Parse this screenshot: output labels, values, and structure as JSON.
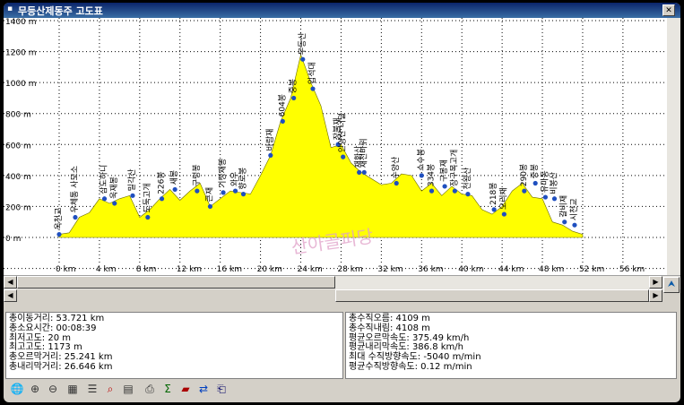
{
  "window": {
    "title": "무등산제동주 고도표"
  },
  "chart_data": {
    "type": "area",
    "x": [
      0,
      1,
      2,
      3,
      4,
      5,
      6,
      7,
      8,
      9,
      10,
      11,
      12,
      13,
      14,
      15,
      16,
      17,
      18,
      19,
      20,
      21,
      22,
      23,
      23.5,
      24,
      25,
      26,
      27,
      28,
      29,
      30,
      31,
      32,
      33,
      34,
      35,
      36,
      37,
      38,
      39,
      40,
      41,
      42,
      43,
      44,
      45,
      46,
      47,
      48,
      49,
      50,
      51,
      52
    ],
    "y": [
      20,
      30,
      130,
      160,
      250,
      220,
      250,
      270,
      130,
      180,
      250,
      310,
      240,
      300,
      350,
      200,
      250,
      300,
      290,
      280,
      400,
      530,
      750,
      900,
      1040,
      1180,
      1000,
      850,
      580,
      600,
      480,
      420,
      380,
      340,
      350,
      410,
      400,
      300,
      350,
      270,
      330,
      280,
      270,
      180,
      150,
      200,
      300,
      350,
      260,
      250,
      100,
      80,
      40,
      20
    ],
    "xticks": [
      "0 km",
      "4 km",
      "8 km",
      "12 km",
      "16 km",
      "20 km",
      "24 km",
      "28 km",
      "32 km",
      "36 km",
      "40 km",
      "44 km",
      "48 km",
      "52 km",
      "56 km"
    ],
    "yticks": [
      "0 m",
      "200 m",
      "400 m",
      "600 m",
      "800 m",
      "1000 m",
      "1200 m",
      "1400 m"
    ],
    "xlim": [
      0,
      56
    ],
    "ylim": [
      0,
      1400
    ],
    "grid": true,
    "fill_color": "#ffff00",
    "marker_color": "#1f4fbf",
    "waypoints": [
      {
        "x": 0,
        "y": 20,
        "label": "옥천교"
      },
      {
        "x": 1.6,
        "y": 130,
        "label": "우체통 사모소"
      },
      {
        "x": 4.5,
        "y": 250,
        "label": "삼도하니"
      },
      {
        "x": 5.5,
        "y": 220,
        "label": "욱재봉"
      },
      {
        "x": 7.3,
        "y": 270,
        "label": "밀각산"
      },
      {
        "x": 8.8,
        "y": 130,
        "label": "도둑고개"
      },
      {
        "x": 10.2,
        "y": 250,
        "label": "226봉"
      },
      {
        "x": 11.5,
        "y": 310,
        "label": "새봉"
      },
      {
        "x": 13.7,
        "y": 300,
        "label": "구렁봉"
      },
      {
        "x": 15,
        "y": 200,
        "label": "큰재"
      },
      {
        "x": 16.3,
        "y": 290,
        "label": "기정재봉"
      },
      {
        "x": 17.5,
        "y": 300,
        "label": "와우"
      },
      {
        "x": 18.3,
        "y": 280,
        "label": "향로봉"
      },
      {
        "x": 21,
        "y": 530,
        "label": "바람재"
      },
      {
        "x": 22.2,
        "y": 750,
        "label": "604봉"
      },
      {
        "x": 23.3,
        "y": 900,
        "label": "중봉"
      },
      {
        "x": 24.2,
        "y": 1150,
        "label": "무등산"
      },
      {
        "x": 25.2,
        "y": 960,
        "label": "입석대"
      },
      {
        "x": 27.7,
        "y": 600,
        "label": "장불재"
      },
      {
        "x": 28.2,
        "y": 520,
        "label": "안양산 너덜"
      },
      {
        "x": 29.8,
        "y": 420,
        "label": "재화산"
      },
      {
        "x": 30.3,
        "y": 420,
        "label": "재천바위"
      },
      {
        "x": 33.5,
        "y": 350,
        "label": "수양산"
      },
      {
        "x": 36,
        "y": 400,
        "label": "소수봉"
      },
      {
        "x": 37,
        "y": 300,
        "label": "334봉"
      },
      {
        "x": 38.3,
        "y": 330,
        "label": "구봉재"
      },
      {
        "x": 39.3,
        "y": 300,
        "label": "장구목고개"
      },
      {
        "x": 40.6,
        "y": 280,
        "label": "천왕산"
      },
      {
        "x": 43.2,
        "y": 180,
        "label": "218봉"
      },
      {
        "x": 44.2,
        "y": 150,
        "label": "오리재"
      },
      {
        "x": 46.2,
        "y": 300,
        "label": "290봉"
      },
      {
        "x": 47.3,
        "y": 350,
        "label": "증봉"
      },
      {
        "x": 48.3,
        "y": 260,
        "label": "유마동"
      },
      {
        "x": 49.2,
        "y": 250,
        "label": "비봉산"
      },
      {
        "x": 50.2,
        "y": 100,
        "label": "갈비재"
      },
      {
        "x": 51.2,
        "y": 80,
        "label": "시천교"
      }
    ],
    "watermark": "산아골피당"
  },
  "stats_left": [
    "총이동거리: 53.721 km",
    "총소요시간: 00:08:39",
    "최저고도: 20 m",
    "최고고도: 1173 m",
    "총오르막거리: 25.241 km",
    "총내리막거리: 26.646 km"
  ],
  "stats_right": [
    "총수직오름: 4109 m",
    "총수직내림: 4108 m",
    "평균오르막속도: 375.49 km/h",
    "평균내리막속도: 386.8 km/h",
    "최대 수직방향속도: -5040 m/min",
    "평균수직방향속도: 0.12 m/min"
  ],
  "toolbar": {
    "icons": [
      "globe-icon",
      "zoom-in-icon",
      "zoom-out-icon",
      "grid-icon",
      "list-icon",
      "magnifier-icon",
      "page-icon",
      "print-icon",
      "sigma-icon",
      "book-icon",
      "swap-icon",
      "export-icon"
    ]
  },
  "icons": {
    "expand": "chevron-double-up-icon"
  },
  "colors": {
    "titlebar": "#0a246a",
    "chart_fill": "#ffff00",
    "marker": "#1f4fbf"
  }
}
